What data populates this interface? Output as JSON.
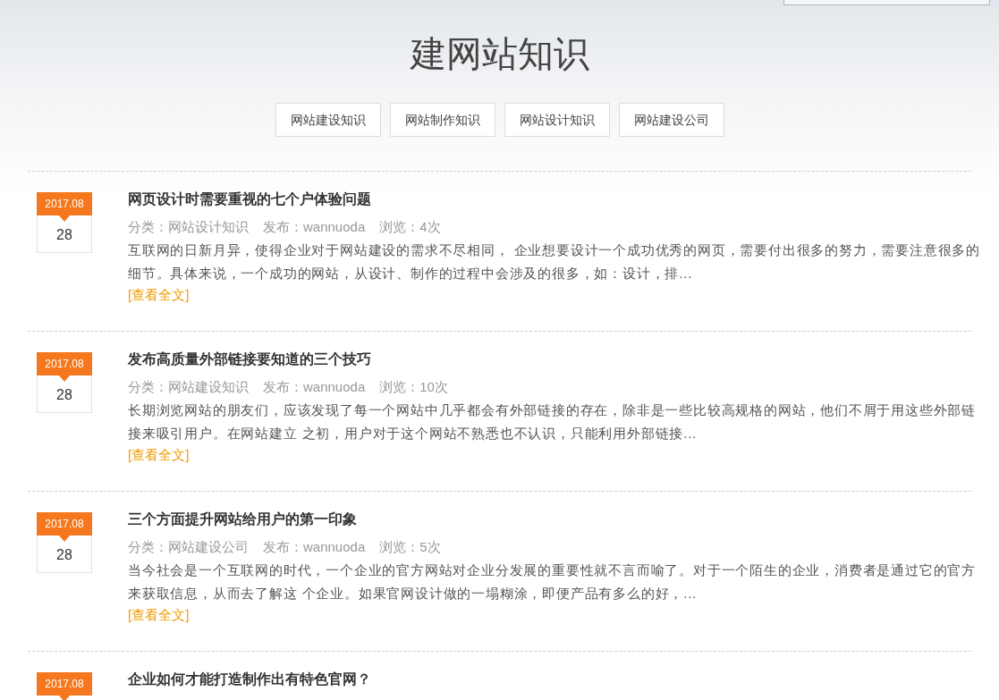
{
  "page_title": "建网站知识",
  "categories": [
    {
      "label": "网站建设知识"
    },
    {
      "label": "网站制作知识"
    },
    {
      "label": "网站设计知识"
    },
    {
      "label": "网站建设公司"
    }
  ],
  "articles": [
    {
      "month": "2017.08",
      "day": "28",
      "title": "网页设计时需要重视的七个户体验问题",
      "category": "分类：网站设计知识",
      "author": "发布：wannuoda",
      "views": "浏览：4次",
      "excerpt": "互联网的日新月异，使得企业对于网站建设的需求不尽相同， 企业想要设计一个成功优秀的网页，需要付出很多的努力，需要注意很多的细节。具体来说，一个成功的网站，从设计、制作的过程中会涉及的很多，如：设计，排...",
      "more": "[查看全文]"
    },
    {
      "month": "2017.08",
      "day": "28",
      "title": "发布高质量外部链接要知道的三个技巧",
      "category": "分类：网站建设知识",
      "author": "发布：wannuoda",
      "views": "浏览：10次",
      "excerpt": "长期浏览网站的朋友们，应该发现了每一个网站中几乎都会有外部链接的存在，除非是一些比较高规格的网站，他们不屑于用这些外部链接来吸引用户。在网站建立 之初，用户对于这个网站不熟悉也不认识，只能利用外部链接...",
      "more": "[查看全文]"
    },
    {
      "month": "2017.08",
      "day": "28",
      "title": "三个方面提升网站给用户的第一印象",
      "category": "分类：网站建设公司",
      "author": "发布：wannuoda",
      "views": "浏览：5次",
      "excerpt": "当今社会是一个互联网的时代，一个企业的官方网站对企业分发展的重要性就不言而喻了。对于一个陌生的企业，消费者是通过它的官方来获取信息，从而去了解这 个企业。如果官网设计做的一塌糊涂，即便产品有多么的好，...",
      "more": "[查看全文]"
    },
    {
      "month": "2017.08",
      "title": "企业如何才能打造制作出有特色官网？"
    }
  ]
}
